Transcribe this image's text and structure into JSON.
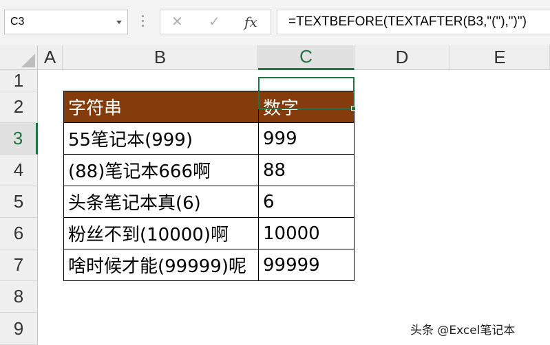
{
  "name_box": "C3",
  "formula_bar": {
    "cancel_icon": "✕",
    "enter_icon": "✓",
    "fx_label": "fx",
    "formula": "=TEXTBEFORE(TEXTAFTER(B3,\"(\"),\")\")"
  },
  "columns": [
    "A",
    "B",
    "C",
    "D",
    "E"
  ],
  "rows": [
    "1",
    "2",
    "3",
    "4",
    "5",
    "6",
    "7",
    "8",
    "9"
  ],
  "selected_cell": "C3",
  "table": {
    "header": [
      "字符串",
      "数字"
    ],
    "header_color": "#843c0c",
    "rows": [
      [
        "55笔记本(999)",
        "999"
      ],
      [
        "(88)笔记本666啊",
        "88"
      ],
      [
        "头条笔记本真(6)",
        "6"
      ],
      [
        "粉丝不到(10000)啊",
        "10000"
      ],
      [
        "啥时候才能(99999)呢",
        "99999"
      ]
    ]
  },
  "watermark": "头条 @Excel笔记本",
  "accent_color": "#217346"
}
